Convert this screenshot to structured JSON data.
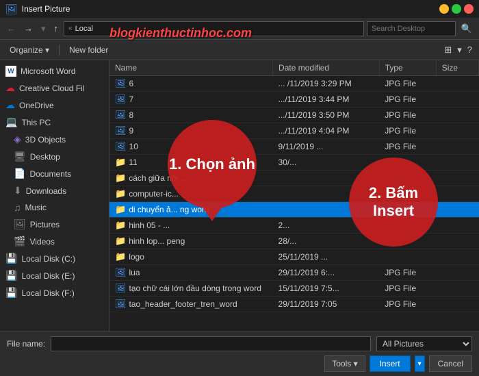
{
  "titlebar": {
    "title": "Insert Picture",
    "icon": "🖼"
  },
  "toolbar": {
    "back_label": "←",
    "forward_label": "→",
    "up_label": "↑",
    "address": "« Local",
    "search_placeholder": "Search Desktop"
  },
  "actionbar": {
    "organize_label": "Organize ▾",
    "new_folder_label": "New folder"
  },
  "table": {
    "headers": [
      "Name",
      "Date modified",
      "Type",
      "Size"
    ],
    "rows": [
      {
        "name": "6",
        "date": "... /11/2019 3:29 PM",
        "type": "JPG File",
        "size": ""
      },
      {
        "name": "7",
        "date": ".../11/2019 3:44 PM",
        "type": "JPG File",
        "size": ""
      },
      {
        "name": "8",
        "date": ".../11/2019 3:50 PM",
        "type": "JPG File",
        "size": ""
      },
      {
        "name": "9",
        "date": ".../11/2019 4:04 PM",
        "type": "JPG File",
        "size": ""
      },
      {
        "name": "10",
        "date": "9/11/2019 ...",
        "type": "JPG File",
        "size": ""
      },
      {
        "name": "11",
        "date": "30/...",
        "type": "",
        "size": ""
      },
      {
        "name": "cách giữa nội ...",
        "date": "",
        "type": "",
        "size": ""
      },
      {
        "name": "computer-ic...",
        "date": "",
        "type": "",
        "size": ""
      },
      {
        "name": "di chuyển ả... ng word",
        "date": "",
        "type": "",
        "size": "",
        "selected": true
      },
      {
        "name": "hinh 05 - ...",
        "date": "2...",
        "type": "",
        "size": ""
      },
      {
        "name": "hinh lop... peng",
        "date": "28/...",
        "type": "",
        "size": ""
      },
      {
        "name": "logo",
        "date": "25/11/2019 ...",
        "type": "",
        "size": ""
      },
      {
        "name": "lua",
        "date": "29/11/2019 6:...",
        "type": "JPG File",
        "size": ""
      },
      {
        "name": "tạo chữ cái lớn đầu dòng trong word",
        "date": "15/11/2019 7:5...",
        "type": "JPG File",
        "size": ""
      },
      {
        "name": "tao_header_footer_tren_word",
        "date": "29/11/2019 7:05",
        "type": "JPG File",
        "size": ""
      }
    ]
  },
  "sidebar": {
    "items": [
      {
        "label": "Microsoft Word",
        "icon": "W",
        "type": "word",
        "sub": false
      },
      {
        "label": "Creative Cloud Fil",
        "icon": "☁",
        "type": "cc",
        "sub": false
      },
      {
        "label": "OneDrive",
        "icon": "☁",
        "type": "onedrive",
        "sub": false
      },
      {
        "label": "This PC",
        "icon": "💻",
        "type": "thispc",
        "sub": false
      },
      {
        "label": "3D Objects",
        "icon": "◈",
        "type": "objects3d",
        "sub": true
      },
      {
        "label": "Desktop",
        "icon": "🖥",
        "type": "desktop",
        "sub": true
      },
      {
        "label": "Documents",
        "icon": "📄",
        "type": "docs",
        "sub": true
      },
      {
        "label": "Downloads",
        "icon": "⬇",
        "type": "downloads",
        "sub": true
      },
      {
        "label": "Music",
        "icon": "♫",
        "type": "music",
        "sub": true
      },
      {
        "label": "Pictures",
        "icon": "🖼",
        "type": "pictures",
        "sub": true
      },
      {
        "label": "Videos",
        "icon": "🎬",
        "type": "videos",
        "sub": true
      },
      {
        "label": "Local Disk (C:)",
        "icon": "💾",
        "type": "disk",
        "sub": false
      },
      {
        "label": "Local Disk (E:)",
        "icon": "💾",
        "type": "disk",
        "sub": false
      },
      {
        "label": "Local Disk (F:)",
        "icon": "💾",
        "type": "disk",
        "sub": false
      }
    ]
  },
  "bottom": {
    "file_name_label": "File name:",
    "file_name_value": "",
    "file_type_value": "All Pictures",
    "tools_label": "Tools ▾",
    "insert_label": "Insert",
    "cancel_label": "Cancel"
  },
  "overlays": {
    "callout1_text": "1. Chọn ảnh",
    "callout2_text": "2. Bấm Insert",
    "watermark": "blogkienthuctinhoc.com"
  }
}
